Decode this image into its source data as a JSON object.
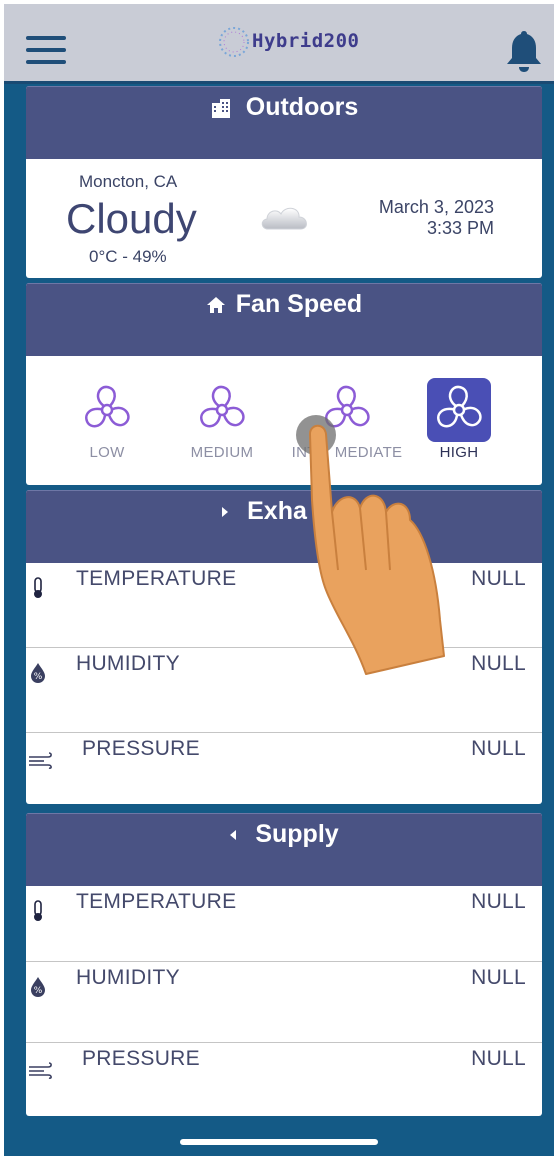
{
  "app": {
    "logo_text": "Hybrid200"
  },
  "outdoors": {
    "title": "Outdoors",
    "location": "Moncton, CA",
    "condition": "Cloudy",
    "temp_humidity": "0°C - 49%",
    "date": "March 3, 2023",
    "time": "3:33 PM"
  },
  "fan_speed": {
    "title": "Fan Speed",
    "options": [
      {
        "label": "LOW"
      },
      {
        "label": "MEDIUM"
      },
      {
        "label": "INTERMEDIATE",
        "visible_label_start": "INT",
        "visible_label_end": "MEDIATE"
      },
      {
        "label": "HIGH"
      }
    ],
    "selected": "HIGH"
  },
  "exhaust": {
    "title": "Exha",
    "rows": [
      {
        "label": "TEMPERATURE",
        "value": "NULL"
      },
      {
        "label": "HUMIDITY",
        "value": "NULL"
      },
      {
        "label": "PRESSURE",
        "value": "NULL"
      }
    ]
  },
  "supply": {
    "title": "Supply",
    "rows": [
      {
        "label": "TEMPERATURE",
        "value": "NULL"
      },
      {
        "label": "HUMIDITY",
        "value": "NULL"
      },
      {
        "label": "PRESSURE",
        "value": "NULL"
      }
    ]
  },
  "icons": {
    "menu": "hamburger-menu-icon",
    "notifications": "bell-icon",
    "outdoors": "building-icon",
    "fan_speed": "home-icon",
    "exhaust": "caret-right-icon",
    "supply": "caret-left-icon",
    "temperature": "thermometer-icon",
    "humidity": "humidity-drop-icon",
    "pressure": "wind-icon",
    "weather": "cloud-icon",
    "fan": "fan-icon"
  },
  "colors": {
    "background": "#145a86",
    "topbar": "#c9ccd6",
    "card_header": "#4a5384",
    "fan_selected": "#4a4fb5",
    "fan_icon": "#8c5cd6"
  }
}
